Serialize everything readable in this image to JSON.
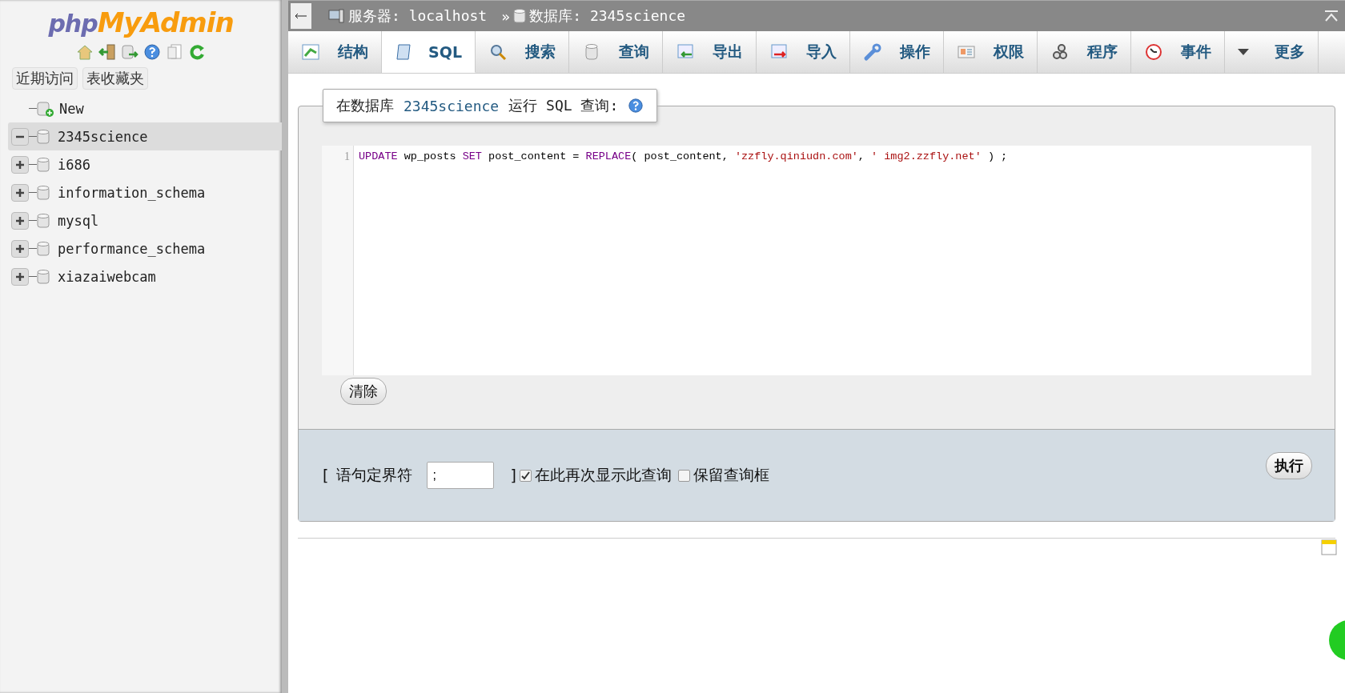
{
  "logo": {
    "part1": "php",
    "part2": "MyAdmin"
  },
  "sidebar_buttons": [
    "近期访问",
    "表收藏夹"
  ],
  "tree": [
    {
      "label": "New",
      "kind": "new"
    },
    {
      "label": "2345science",
      "kind": "db",
      "expanded": true,
      "selected": true
    },
    {
      "label": "i686",
      "kind": "db",
      "expanded": false,
      "selected": false
    },
    {
      "label": "information_schema",
      "kind": "db",
      "expanded": false,
      "selected": false
    },
    {
      "label": "mysql",
      "kind": "db",
      "expanded": false,
      "selected": false
    },
    {
      "label": "performance_schema",
      "kind": "db",
      "expanded": false,
      "selected": false
    },
    {
      "label": "xiazaiwebcam",
      "kind": "db",
      "expanded": false,
      "selected": false
    }
  ],
  "breadcrumb": {
    "server": "服务器: localhost",
    "separator": "»",
    "database": "数据库: 2345science"
  },
  "tabs": [
    {
      "label": "结构",
      "selected": false
    },
    {
      "label": "SQL",
      "selected": true
    },
    {
      "label": "搜索",
      "selected": false
    },
    {
      "label": "查询",
      "selected": false
    },
    {
      "label": "导出",
      "selected": false
    },
    {
      "label": "导入",
      "selected": false
    },
    {
      "label": "操作",
      "selected": false
    },
    {
      "label": "权限",
      "selected": false
    },
    {
      "label": "程序",
      "selected": false
    },
    {
      "label": "事件",
      "selected": false
    },
    {
      "label": "更多",
      "selected": false
    }
  ],
  "legend": {
    "prefix": "在数据库",
    "database": "2345science",
    "suffix": "运行 SQL 查询:"
  },
  "editor": {
    "line_number": "1",
    "tokens": [
      {
        "kind": "keyword",
        "text": "UPDATE"
      },
      {
        "kind": "plain",
        "text": " wp_posts "
      },
      {
        "kind": "keyword",
        "text": "SET"
      },
      {
        "kind": "plain",
        "text": " post_content = "
      },
      {
        "kind": "keyword",
        "text": "REPLACE"
      },
      {
        "kind": "plain",
        "text": "( post_content, "
      },
      {
        "kind": "string",
        "text": "'zzfly.qiniudn.com'"
      },
      {
        "kind": "plain",
        "text": ", "
      },
      {
        "kind": "string",
        "text": "' img2.zzfly.net'"
      },
      {
        "kind": "plain",
        "text": " ) ;"
      }
    ]
  },
  "clear_button": "清除",
  "options": {
    "bracket_open": "[",
    "delimiter_label": "语句定界符",
    "delimiter_value": ";",
    "bracket_close": "]",
    "show_query": {
      "label": "在此再次显示此查询",
      "checked": true
    },
    "retain_box": {
      "label": "保留查询框",
      "checked": false
    },
    "go_button": "执行"
  }
}
